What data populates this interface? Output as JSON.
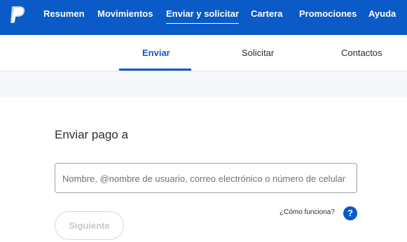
{
  "nav": {
    "logo": "paypal-logo",
    "items": [
      {
        "label": "Resumen"
      },
      {
        "label": "Movimientos"
      },
      {
        "label": "Enviar y solicitar",
        "active": true
      },
      {
        "label": "Cartera"
      },
      {
        "label": "Promociones"
      },
      {
        "label": "Ayuda"
      }
    ]
  },
  "subnav": {
    "tabs": [
      {
        "label": "Enviar",
        "active": true
      },
      {
        "label": "Solicitar"
      },
      {
        "label": "Contactos"
      }
    ]
  },
  "form": {
    "heading": "Enviar pago a",
    "recipient_placeholder": "Nombre, @nombre de usuario, correo electrónico o número de celular",
    "help_link": "¿Cómo funciona?",
    "help_icon": "?",
    "next_button": "Siguiente"
  },
  "colors": {
    "brand_blue": "#0a5ac8",
    "grey_band": "#f5f7fa"
  }
}
